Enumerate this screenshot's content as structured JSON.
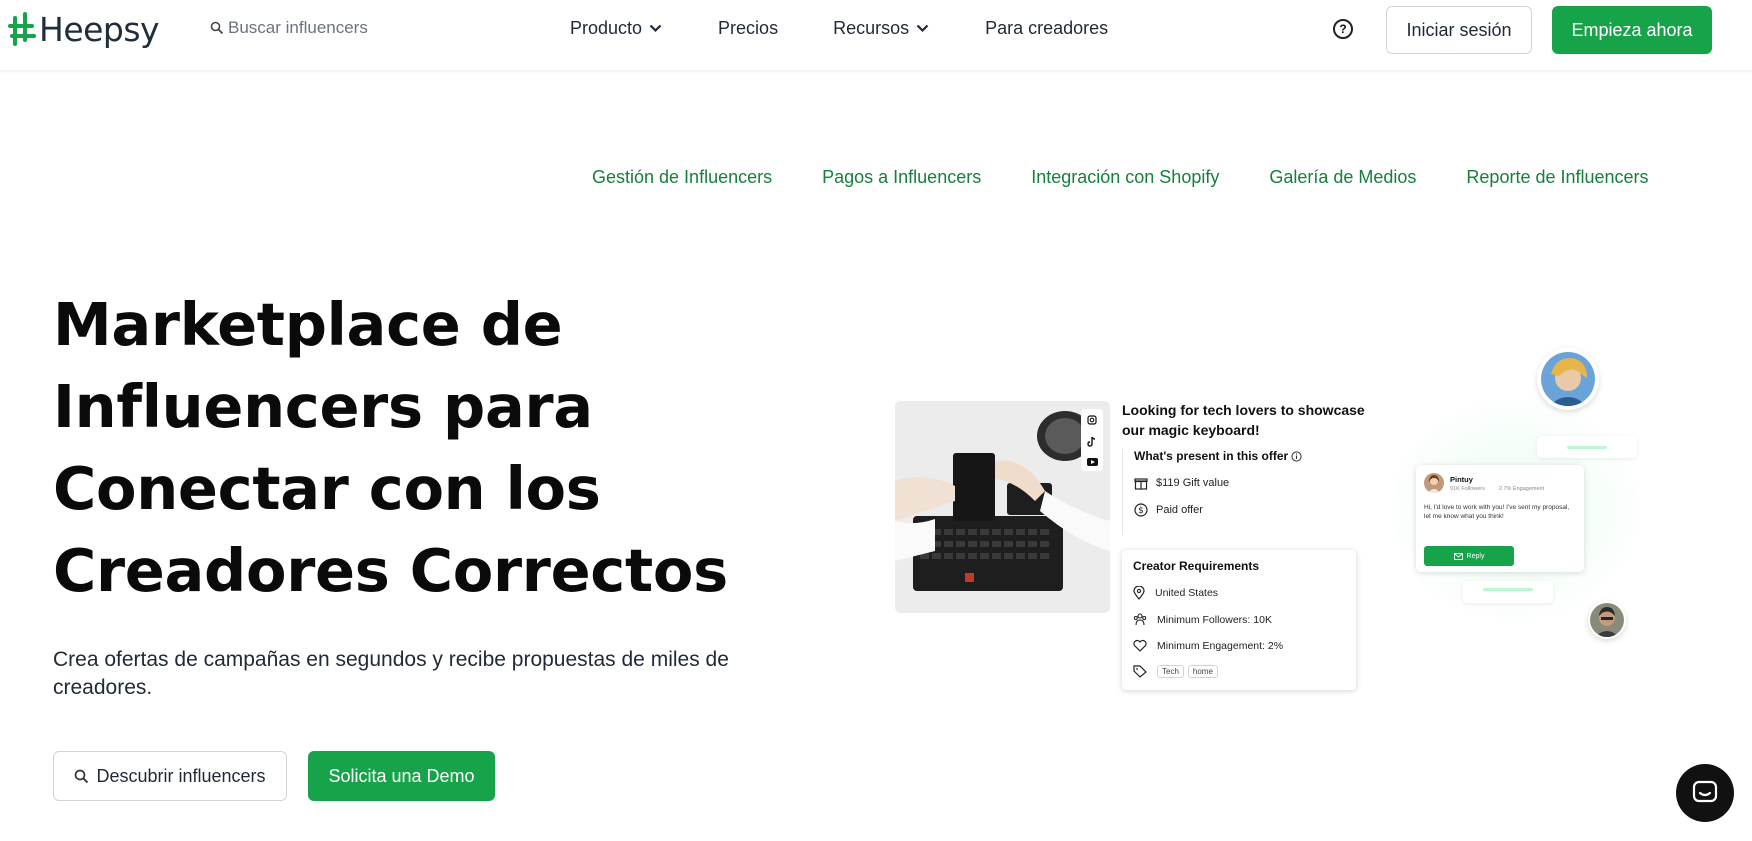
{
  "header": {
    "logo_text": "Heepsy",
    "search_placeholder": "Buscar influencers",
    "nav": {
      "producto": "Producto",
      "precios": "Precios",
      "recursos": "Recursos",
      "creadores": "Para creadores"
    },
    "help_glyph": "?",
    "login_label": "Iniciar sesión",
    "start_label": "Empieza ahora"
  },
  "subnav": {
    "items": [
      "Gestión de Influencers",
      "Pagos a Influencers",
      "Integración con Shopify",
      "Galería de Medios",
      "Reporte de Influencers"
    ]
  },
  "hero": {
    "title_lines": [
      "Marketplace de",
      "Influencers para",
      "Conectar con los",
      "Creadores Correctos"
    ],
    "subtitle": "Crea ofertas de campañas en segundos y recibe propuestas de miles de creadores.",
    "discover_label": "Descubrir influencers",
    "demo_label": "Solicita una Demo"
  },
  "mock": {
    "offer_title": "Looking for tech lovers to showcase our magic keyboard!",
    "offer_heading": "What's present in this offer",
    "gift_value": "$119 Gift value",
    "paid_offer": "Paid offer",
    "requirements_heading": "Creator Requirements",
    "location": "United States",
    "min_followers": "Minimum Followers: 10K",
    "min_engagement": "Minimum Engagement: 2%",
    "tags": [
      "Tech",
      "home"
    ],
    "chat": {
      "name": "Pintuy",
      "followers": "91K Followers",
      "engagement": "2.7% Engagement",
      "message": "Hi, I'd love to work with you! I've sent my proposal, let me know what you think!",
      "reply_label": "Reply"
    }
  },
  "colors": {
    "brand_green": "#16a34a",
    "subnav_green": "#15803d",
    "text_dark": "#0a0a0a"
  },
  "icons": [
    "logo-mark-icon",
    "search-icon",
    "chevron-down-icon",
    "help-icon",
    "instagram-icon",
    "tiktok-icon",
    "youtube-icon",
    "info-icon",
    "gift-icon",
    "dollar-icon",
    "location-icon",
    "followers-icon",
    "heart-icon",
    "tag-icon",
    "mail-icon",
    "chat-icon"
  ]
}
